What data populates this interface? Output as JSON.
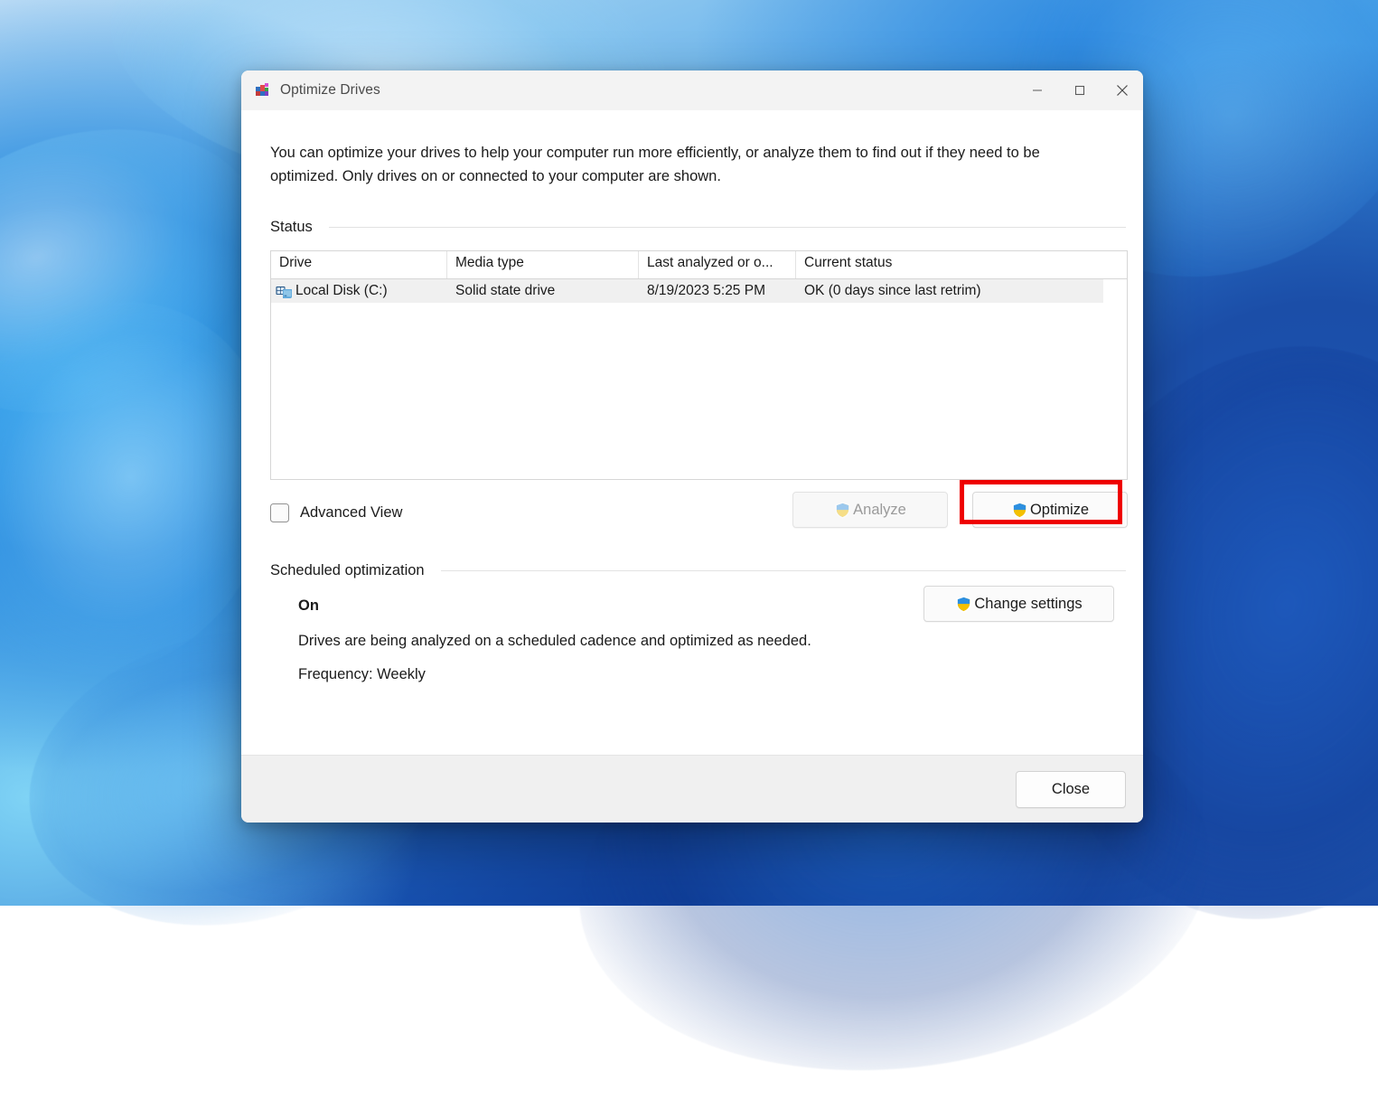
{
  "window": {
    "title": "Optimize Drives",
    "app_icon": "defrag-icon",
    "minimize_label": "Minimize",
    "maximize_label": "Maximize",
    "close_label": "Close"
  },
  "intro": "You can optimize your drives to help your computer run more efficiently, or analyze them to find out if they need to be optimized. Only drives on or connected to your computer are shown.",
  "status_section": {
    "heading": "Status",
    "columns": [
      "Drive",
      "Media type",
      "Last analyzed or o...",
      "Current status"
    ],
    "rows": [
      {
        "icon": "system-drive-icon",
        "drive": "Local Disk (C:)",
        "media_type": "Solid state drive",
        "last_analyzed": "8/19/2023 5:25 PM",
        "current_status": "OK (0 days since last retrim)",
        "selected": true
      }
    ]
  },
  "controls": {
    "advanced_view_label": "Advanced View",
    "advanced_view_checked": false,
    "analyze_label": "Analyze",
    "analyze_enabled": false,
    "optimize_label": "Optimize",
    "optimize_enabled": true,
    "shield_icon": "uac-shield-icon"
  },
  "annotation": {
    "color": "#ef0000",
    "target": "Optimize"
  },
  "scheduled_section": {
    "heading": "Scheduled optimization",
    "state": "On",
    "description": "Drives are being analyzed on a scheduled cadence and optimized as needed.",
    "frequency": "Frequency: Weekly",
    "change_settings_label": "Change settings"
  },
  "footer": {
    "close_label": "Close"
  },
  "colors": {
    "accent_red": "#ef0000",
    "titlebar_bg": "#f3f3f3",
    "footer_bg": "#f0f0f0",
    "selection_bg": "#f0f0f0"
  }
}
